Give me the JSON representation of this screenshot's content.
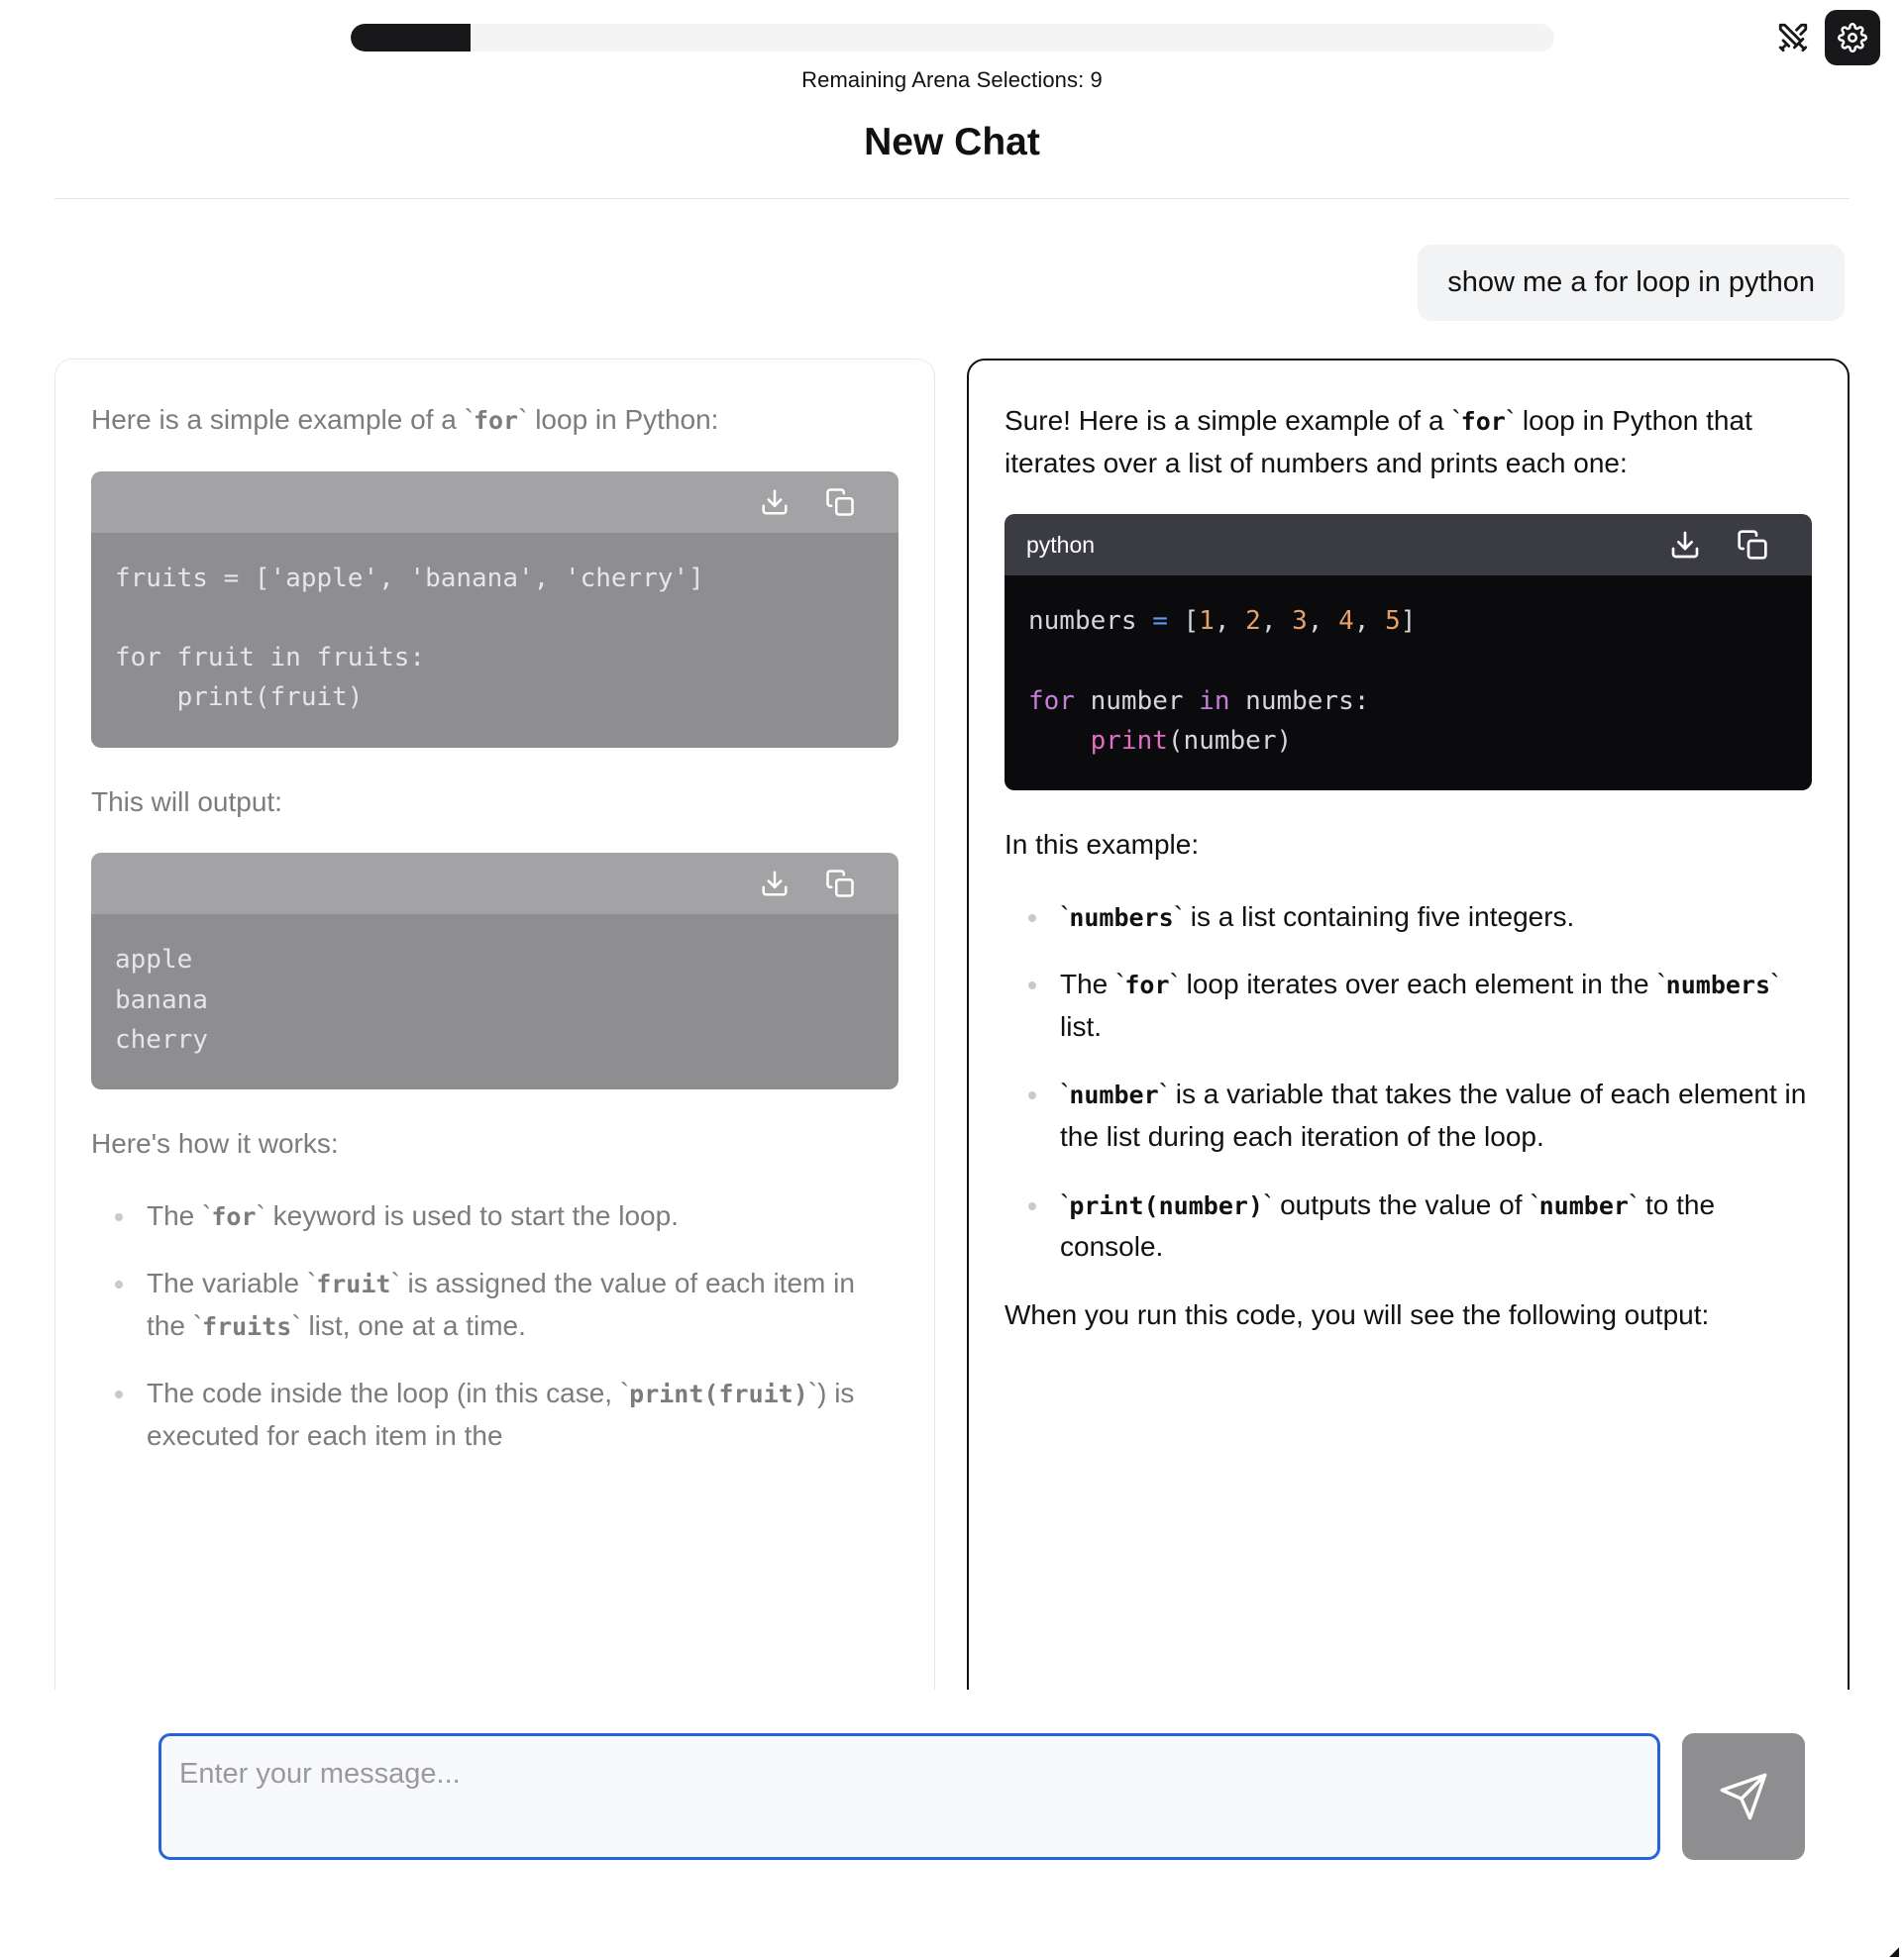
{
  "header": {
    "progress_percent": 10,
    "arena_status": "Remaining Arena Selections: 9",
    "chat_title": "New Chat",
    "swords_icon": "crossed-swords-icon",
    "settings_icon": "gear-icon"
  },
  "conversation": {
    "user_message": "show me a for loop in python"
  },
  "left_response": {
    "intro": "Here is a simple example of a `for` loop in Python:",
    "code_1": {
      "language": "",
      "download_label": "download-icon",
      "copy_label": "copy-icon",
      "lines": "fruits = ['apple', 'banana', 'cherry']\n\nfor fruit in fruits:\n    print(fruit)"
    },
    "output_intro": "This will output:",
    "code_2": {
      "language": "",
      "download_label": "download-icon",
      "copy_label": "copy-icon",
      "lines": "apple\nbanana\ncherry"
    },
    "how_intro": "Here's how it works:",
    "bullets": [
      "The `for` keyword is used to start the loop.",
      "The variable `fruit` is assigned the value of each item in the `fruits` list, one at a time.",
      "The code inside the loop (in this case, `print(fruit)`) is executed for each item in the"
    ]
  },
  "right_response": {
    "intro": "Sure! Here is a simple example of a `for` loop in Python that iterates over a list of numbers and prints each one:",
    "code": {
      "language": "python",
      "download_label": "download-icon",
      "copy_label": "copy-icon",
      "tokens": [
        {
          "t": "numbers ",
          "c": "tk-name"
        },
        {
          "t": "=",
          "c": "tk-op"
        },
        {
          "t": " [",
          "c": "tk-name"
        },
        {
          "t": "1",
          "c": "tk-num"
        },
        {
          "t": ", ",
          "c": "tk-name"
        },
        {
          "t": "2",
          "c": "tk-num"
        },
        {
          "t": ", ",
          "c": "tk-name"
        },
        {
          "t": "3",
          "c": "tk-num"
        },
        {
          "t": ", ",
          "c": "tk-name"
        },
        {
          "t": "4",
          "c": "tk-num"
        },
        {
          "t": ", ",
          "c": "tk-name"
        },
        {
          "t": "5",
          "c": "tk-num"
        },
        {
          "t": "]\n\n",
          "c": "tk-name"
        },
        {
          "t": "for",
          "c": "tk-kw"
        },
        {
          "t": " number ",
          "c": "tk-name"
        },
        {
          "t": "in",
          "c": "tk-kw"
        },
        {
          "t": " numbers:\n    ",
          "c": "tk-name"
        },
        {
          "t": "print",
          "c": "tk-fn"
        },
        {
          "t": "(number)",
          "c": "tk-name"
        }
      ],
      "plain": "numbers = [1, 2, 3, 4, 5]\n\nfor number in numbers:\n    print(number)"
    },
    "example_intro": "In this example:",
    "bullets": [
      "`numbers` is a list containing five integers.",
      "The `for` loop iterates over each element in the `numbers` list.",
      "`number` is a variable that takes the value of each element in the list during each iteration of the loop.",
      "`print(number)` outputs the value of `number` to the console."
    ],
    "closing": "When you run this code, you will see the following output:"
  },
  "composer": {
    "placeholder": "Enter your message...",
    "value": "",
    "send_icon": "send-paper-plane-icon"
  },
  "colors": {
    "accent_border": "#2563d9",
    "progress_fill": "#18181b",
    "muted_code_bg": "#8e8e90",
    "dark_code_bg": "#0b0b0d",
    "send_button": "#8e8e90"
  }
}
